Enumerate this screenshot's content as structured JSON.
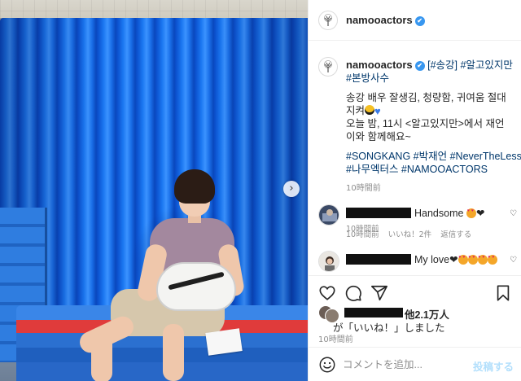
{
  "post": {
    "username": "namooactors",
    "verified_mark": "✔"
  },
  "caption": {
    "username": "namooactors",
    "line1_rest": " [#송강] #알고있지만",
    "line2": "#본방사수",
    "line3": "송강 배우 잘생김, 청량함, 귀여움 절대",
    "line4": "지켜",
    "line5": "오늘 밤, 11시 <알고있지만>에서 재언",
    "line6": "이와 함께해요~",
    "line7": "#SONGKANG #박재언 #NeverTheLess",
    "line8": "#나무엑터스 #NAMOOACTORS",
    "time": "10時間前"
  },
  "comments": [
    {
      "text": "Handsome ",
      "trail": "❤",
      "time": "10時間前",
      "likes": "",
      "reply": ""
    },
    {
      "text": "My love❤",
      "trail": "",
      "time": "10時間前",
      "likes": "いいね！2件",
      "reply": "返信する"
    }
  ],
  "likes": {
    "line1": "他2.1万人",
    "line2": "が「いいね！」しました"
  },
  "post_time": "10時間前",
  "comment_input": {
    "placeholder": "コメントを追加...",
    "post_label": "投稿する"
  },
  "icons": {
    "next": "chevron-right-icon",
    "like": "heart-icon",
    "comment": "comment-icon",
    "share": "paper-plane-icon",
    "save": "bookmark-icon",
    "emoji": "smiley-icon"
  },
  "colors": {
    "accent_link": "#00376b",
    "verified": "#3897f0",
    "post_button_disabled": "#b2dffc"
  }
}
